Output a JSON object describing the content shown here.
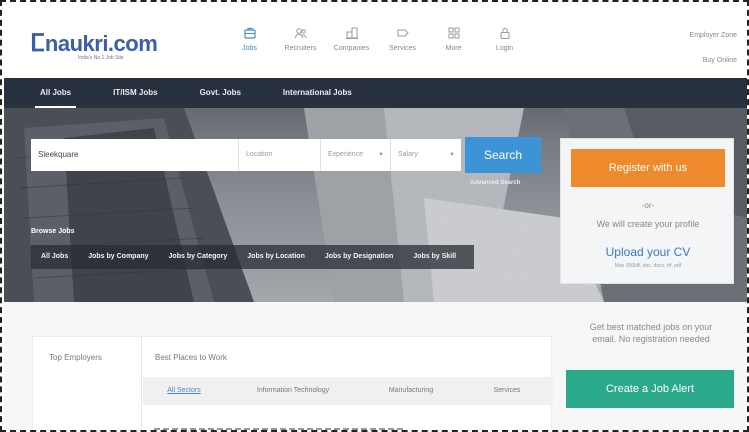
{
  "brand": {
    "logo_mark": "ⵎ",
    "logo_text": "naukri.com",
    "tagline": "India's No.1 Job Site"
  },
  "nav": [
    {
      "label": "Jobs",
      "icon": "briefcase-icon",
      "active": true
    },
    {
      "label": "Recruiters",
      "icon": "people-icon",
      "active": false
    },
    {
      "label": "Companies",
      "icon": "building-icon",
      "active": false
    },
    {
      "label": "Services",
      "icon": "tag-icon",
      "active": false
    },
    {
      "label": "More",
      "icon": "grid-icon",
      "active": false
    },
    {
      "label": "Login",
      "icon": "lock-icon",
      "active": false
    }
  ],
  "header_links": {
    "employer_zone": "Employer Zone",
    "buy_online": "Buy Online"
  },
  "job_tabs": [
    {
      "label": "All Jobs",
      "active": true
    },
    {
      "label": "IT/ISM Jobs",
      "active": false
    },
    {
      "label": "Govt. Jobs",
      "active": false
    },
    {
      "label": "International Jobs",
      "active": false
    }
  ],
  "search": {
    "keyword_value": "Sleekquare",
    "location_placeholder": "Location",
    "experience_placeholder": "Experience",
    "salary_placeholder": "Salary",
    "button": "Search",
    "advanced": "Advanced Search"
  },
  "browse": {
    "title": "Browse Jobs",
    "items": [
      "All Jobs",
      "Jobs by Company",
      "Jobs by Category",
      "Jobs by Location",
      "Jobs by Designation",
      "Jobs by Skill"
    ]
  },
  "register": {
    "button": "Register with us",
    "or": "-or-",
    "create": "We will create your profile",
    "upload": "Upload your CV",
    "formats": "Max 300kB, doc, docx, rtf, pdf"
  },
  "employers": {
    "top": "Top Employers",
    "best": "Best Places to Work",
    "sectors": [
      {
        "label": "All Sectors",
        "active": true
      },
      {
        "label": "Information Technology",
        "active": false
      },
      {
        "label": "Manufacturing",
        "active": false
      },
      {
        "label": "Services",
        "active": false
      }
    ]
  },
  "alert": {
    "text": "Get best matched jobs on your email. No registration needed",
    "button": "Create a Job Alert"
  },
  "colors": {
    "brand_blue": "#3a5ea8",
    "search_blue": "#3c94d6",
    "register_orange": "#ef8a2c",
    "alert_green": "#2aaa8a"
  }
}
